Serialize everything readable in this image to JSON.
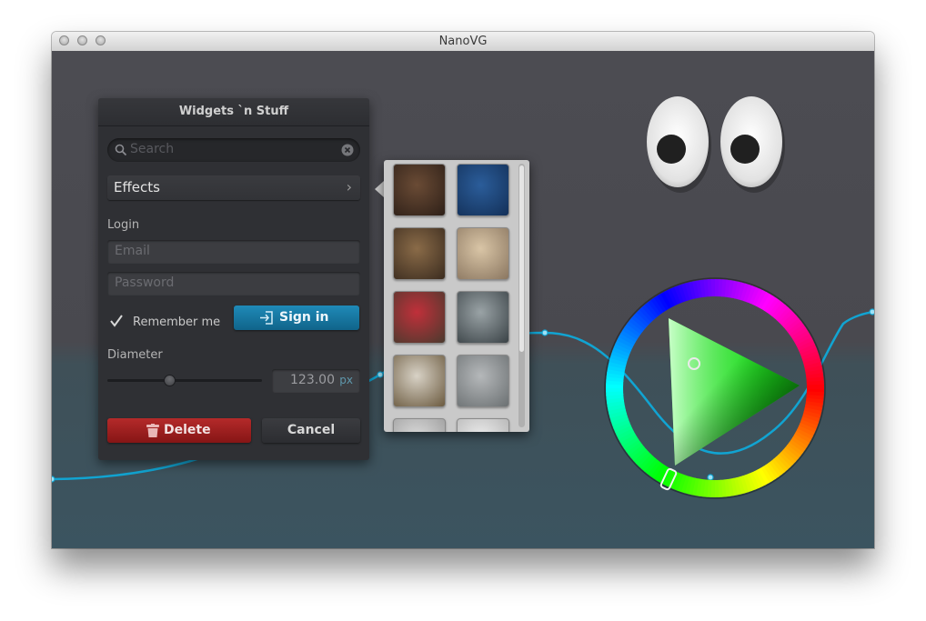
{
  "window": {
    "title": "NanoVG"
  },
  "panel": {
    "title": "Widgets `n Stuff",
    "search_placeholder": "Search",
    "effects_label": "Effects",
    "login_label": "Login",
    "email_placeholder": "Email",
    "password_placeholder": "Password",
    "remember_label": "Remember me",
    "remember_checked": true,
    "signin_label": "Sign in",
    "diameter_label": "Diameter",
    "slider_value_fraction": 0.4,
    "diameter_value": "123.00",
    "diameter_unit": "px",
    "delete_label": "Delete",
    "cancel_label": "Cancel"
  },
  "thumbnails": [
    {
      "name": "thumb-dog",
      "colors": [
        "#6a4b35",
        "#2e2018"
      ]
    },
    {
      "name": "thumb-jellyfish",
      "colors": [
        "#2b5d9a",
        "#133058"
      ]
    },
    {
      "name": "thumb-rodent",
      "colors": [
        "#8a6b48",
        "#3b2c1f"
      ]
    },
    {
      "name": "thumb-bunny",
      "colors": [
        "#d9c5a6",
        "#8a7660"
      ]
    },
    {
      "name": "thumb-cat-hat",
      "colors": [
        "#c0303a",
        "#4a3a2e"
      ]
    },
    {
      "name": "thumb-koala",
      "colors": [
        "#9aa3a6",
        "#3a4246"
      ]
    },
    {
      "name": "thumb-tortoise",
      "colors": [
        "#d8d2c6",
        "#6b5a3f"
      ]
    },
    {
      "name": "thumb-mouse",
      "colors": [
        "#b5b8ba",
        "#6b7072"
      ]
    },
    {
      "name": "thumb-partial-1",
      "colors": [
        "#dcdcdc",
        "#9a9a9a"
      ]
    },
    {
      "name": "thumb-partial-2",
      "colors": [
        "#eeeeee",
        "#b0b0b0"
      ]
    }
  ],
  "colors": {
    "accent_blue": "#1c84b1",
    "danger_red": "#a52020",
    "curve": "#11a4d2"
  },
  "color_wheel": {
    "hue_deg": 120,
    "handle": "selector"
  }
}
